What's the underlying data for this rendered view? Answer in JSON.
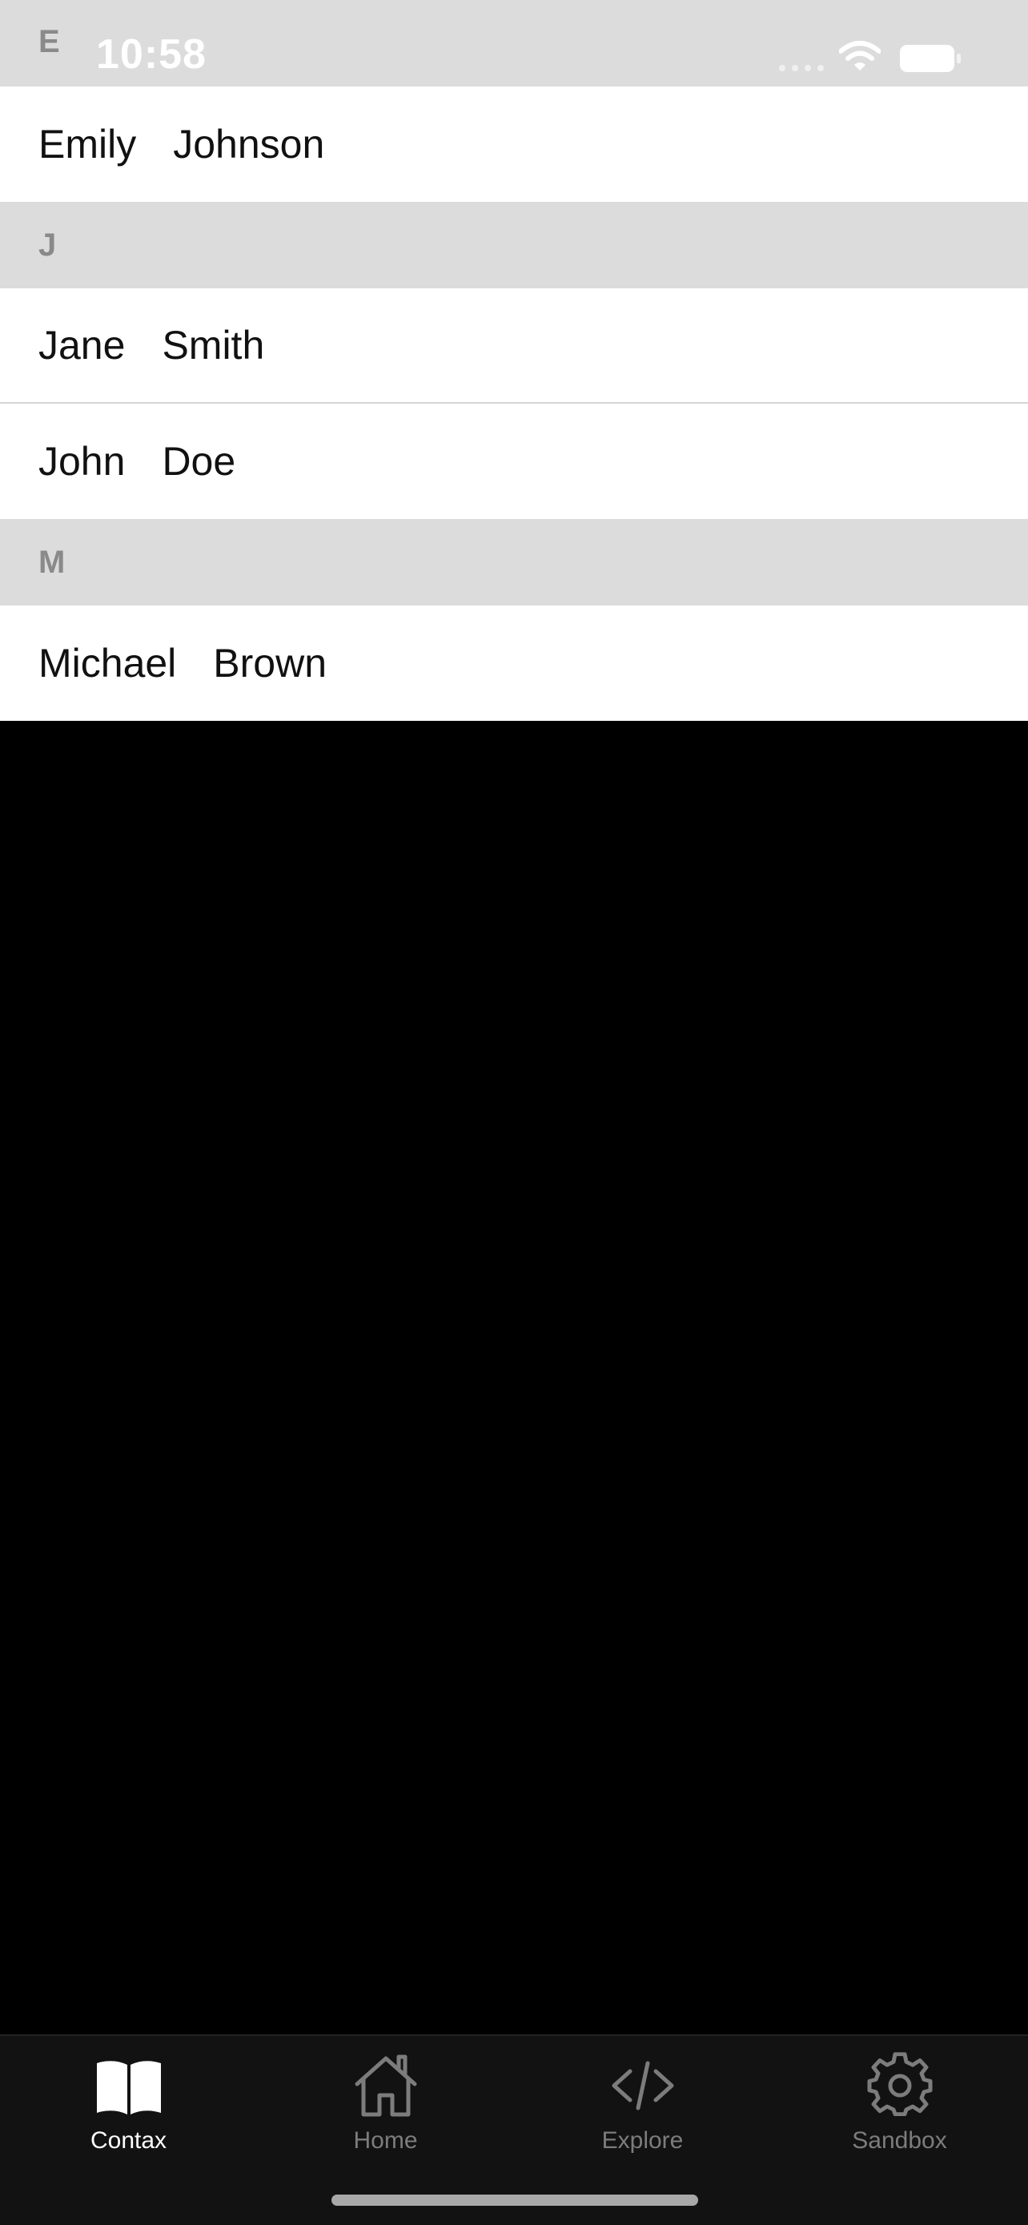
{
  "status_bar": {
    "time": "10:58"
  },
  "contacts": {
    "sections": [
      {
        "letter": "E",
        "people": [
          {
            "first": "Emily",
            "last": "Johnson"
          }
        ]
      },
      {
        "letter": "J",
        "people": [
          {
            "first": "Jane",
            "last": "Smith"
          },
          {
            "first": "John",
            "last": "Doe"
          }
        ]
      },
      {
        "letter": "M",
        "people": [
          {
            "first": "Michael",
            "last": "Brown"
          }
        ]
      }
    ]
  },
  "tab_bar": {
    "tabs": [
      {
        "label": "Contax",
        "icon": "book-icon",
        "active": true
      },
      {
        "label": "Home",
        "icon": "home-icon",
        "active": false
      },
      {
        "label": "Explore",
        "icon": "code-icon",
        "active": false
      },
      {
        "label": "Sandbox",
        "icon": "gear-icon",
        "active": false
      }
    ]
  },
  "colors": {
    "section_header_bg": "#dcdcdc",
    "section_header_text": "#8a8a8a",
    "row_bg": "#ffffff",
    "tab_bar_bg": "#121212",
    "tab_active": "#ffffff",
    "tab_inactive": "#7c7c7c"
  }
}
